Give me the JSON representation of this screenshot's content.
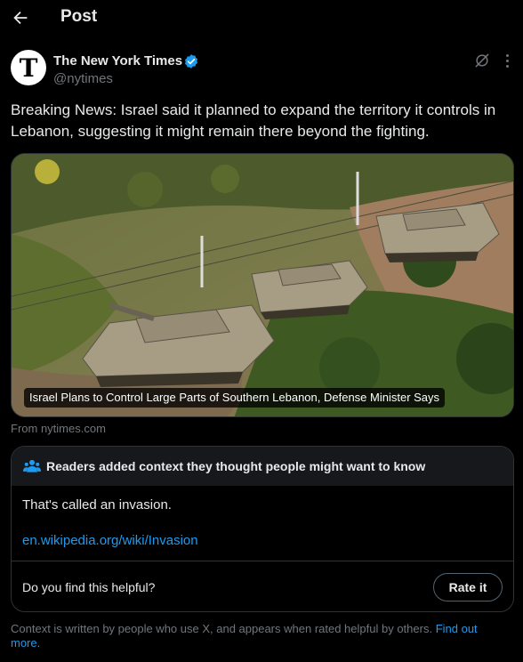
{
  "header": {
    "title": "Post",
    "back_icon": "arrow-left-icon"
  },
  "author": {
    "name": "The New York Times",
    "handle": "@nytimes",
    "avatar_letter": "T",
    "verified_color": "#1d9bf0"
  },
  "post": {
    "text": "Breaking News: Israel said it planned to expand the territory it controls in Lebanon, suggesting it might remain there beyond the fighting.",
    "card_caption": "Israel Plans to Control Large Parts of Southern Lebanon, Defense Minister Says",
    "source": "From nytimes.com"
  },
  "community_note": {
    "title": "Readers added context they thought people might want to know",
    "body": "That's called an invasion.",
    "link": "en.wikipedia.org/wiki/Invasion",
    "helpful_question": "Do you find this helpful?",
    "rate_button": "Rate it"
  },
  "footer": {
    "text": "Context is written by people who use X, and appears when rated helpful by others. ",
    "link": "Find out more."
  },
  "colors": {
    "accent": "#1d9bf0",
    "muted": "#71767b",
    "border": "#2f3336"
  }
}
